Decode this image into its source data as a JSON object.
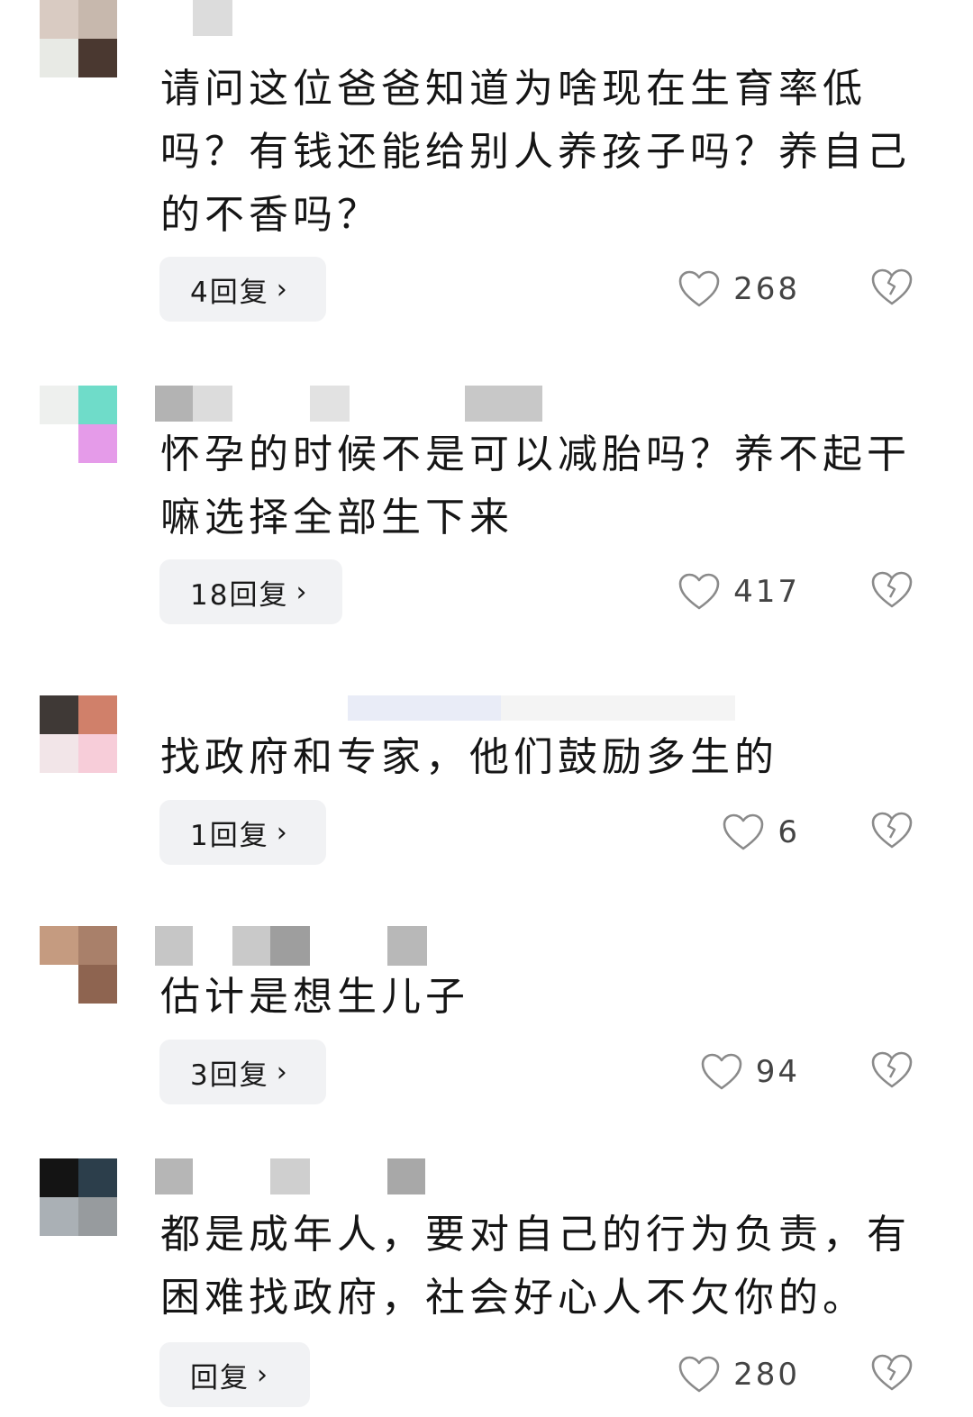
{
  "comments": [
    {
      "text": "请问这位爸爸知道为啥现在生育率低吗？有钱还能给别人养孩子吗？养自己的不香吗？",
      "reply_label": "4回复",
      "likes": "268",
      "avatar_colors": [
        "#d9cbc2",
        "#c7b8ad",
        "#e8eae5",
        "#4a3830"
      ],
      "name_blocks": [
        {
          "color": "#dcdcdc",
          "w": 44
        },
        {
          "color": "#ffffff",
          "w": 0
        }
      ]
    },
    {
      "text": "怀孕的时候不是可以减胎吗？养不起干嘛选择全部生下来",
      "reply_label": "18回复",
      "likes": "417",
      "avatar_colors": [
        "#eef0ee",
        "#6fdcc9",
        "#ffffff",
        "#e59be9"
      ],
      "name_blocks": [
        {
          "color": "#b3b3b3",
          "w": 42
        },
        {
          "color": "#dcdcdc",
          "w": 44
        },
        {
          "color": "#ffffff",
          "w": 86
        },
        {
          "color": "#e2e2e2",
          "w": 44
        },
        {
          "color": "#ffffff",
          "w": 128
        },
        {
          "color": "#c8c8c8",
          "w": 86
        }
      ]
    },
    {
      "text": "找政府和专家，他们鼓励多生的",
      "reply_label": "1回复",
      "likes": "6",
      "avatar_colors": [
        "#3f3936",
        "#d0806a",
        "#f2e5e8",
        "#f7cdd9"
      ],
      "name_blocks": [
        {
          "color": "#ffffff",
          "w": 214
        },
        {
          "color": "#e9ecf7",
          "w": 170
        },
        {
          "color": "#f4f4f4",
          "w": 260
        }
      ]
    },
    {
      "text": "估计是想生儿子",
      "reply_label": "3回复",
      "likes": "94",
      "avatar_colors": [
        "#c59b80",
        "#a9806a",
        "#ffffff",
        "#8e6450"
      ],
      "name_blocks": [
        {
          "color": "#c6c6c6",
          "w": 42
        },
        {
          "color": "#ffffff",
          "w": 44
        },
        {
          "color": "#c9c9c9",
          "w": 42
        },
        {
          "color": "#9e9e9e",
          "w": 44
        },
        {
          "color": "#ffffff",
          "w": 86
        },
        {
          "color": "#b8b8b8",
          "w": 44
        }
      ]
    },
    {
      "text": "都是成年人，要对自己的行为负责，有困难找政府，社会好心人不欠你的。",
      "reply_label": "回复",
      "likes": "280",
      "avatar_colors": [
        "#141414",
        "#2c3e4b",
        "#aab0b5",
        "#979b9e"
      ],
      "name_blocks": [
        {
          "color": "#b6b6b6",
          "w": 42
        },
        {
          "color": "#ffffff",
          "w": 86
        },
        {
          "color": "#cfcfcf",
          "w": 44
        },
        {
          "color": "#ffffff",
          "w": 86
        },
        {
          "color": "#a8a8a8",
          "w": 42
        }
      ]
    }
  ],
  "icons": {
    "like": "heart-outline-icon",
    "dislike": "broken-heart-icon",
    "chevron": "chevron-right-icon"
  },
  "chevron_glyph": "›"
}
